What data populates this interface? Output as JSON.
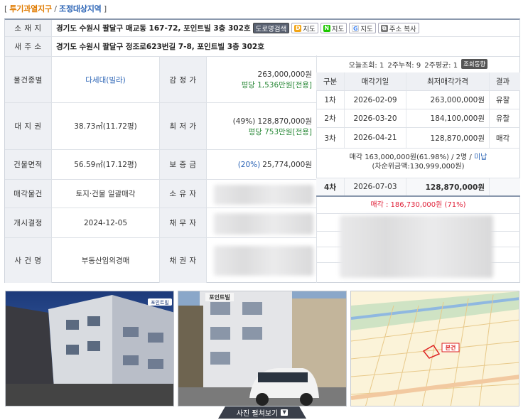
{
  "tags": {
    "open": "[",
    "tag1": "투기과열지구",
    "sep": "/",
    "tag2": "조정대상지역",
    "close": "]"
  },
  "location": {
    "label": "소 재 지",
    "value": "경기도 수원시 팔달구 매교동 167-72, 포인트빌 3층 302호",
    "btn_road": "도로명검색",
    "btn_map_d": "지도",
    "btn_map_n": "지도",
    "btn_map_g": "지도",
    "btn_copy": "주소 복사"
  },
  "new_address": {
    "label": "새 주 소",
    "value": "경기도 수원시 팔달구 정조로623번길 7-8, 포인트빌 3층 302호"
  },
  "fields": {
    "type_label": "물건종별",
    "type_value": "다세대(빌라)",
    "appraisal_label": "감 정 가",
    "appraisal_value": "263,000,000원",
    "appraisal_unit": "평당 1,536만원[전용]",
    "land_label": "대 지 권",
    "land_value": "38.73㎡(11.72평)",
    "min_label": "최 저 가",
    "min_value": "(49%) 128,870,000원",
    "min_unit": "평당 753만원[전용]",
    "building_label": "건물면적",
    "building_value": "56.59㎡(17.12평)",
    "deposit_label": "보 증 금",
    "deposit_pct": "(20%)",
    "deposit_value": "25,774,000원",
    "sale_label": "매각물건",
    "sale_value": "토지·건물 일괄매각",
    "owner_label": "소 유 자",
    "start_label": "개시결정",
    "start_value": "2024-12-05",
    "debtor_label": "채 무 자",
    "case_label": "사 건 명",
    "case_value": "부동산임의경매",
    "creditor_label": "채 권 자"
  },
  "history": {
    "today": "오늘조회: 1",
    "twoweek": "2주누적: 9",
    "avg": "2주평균: 1",
    "trend_btn": "조회동향",
    "headers": [
      "구분",
      "매각기일",
      "최저매각가격",
      "결과"
    ],
    "rows": [
      {
        "round": "1차",
        "date": "2026-02-09",
        "price": "263,000,000원",
        "result": "유찰"
      },
      {
        "round": "2차",
        "date": "2026-03-20",
        "price": "184,100,000원",
        "result": "유찰"
      },
      {
        "round": "3차",
        "date": "2026-04-21",
        "price": "128,870,000원",
        "result": "매각"
      }
    ],
    "sold_line1_a": "매각 163,000,000원(61.98%) / 2명 / ",
    "sold_line1_b": "미납",
    "sold_line2": "(차순위금액:130,999,000원)",
    "next": {
      "round": "4차",
      "date": "2026-07-03",
      "price": "128,870,000원"
    },
    "final_a": "매각 : 186,730,000원",
    "final_b": "(71%)"
  },
  "photos": {
    "p1_badge": "포인트빌",
    "p2_sign": "포인트빌",
    "map_label": "본건"
  },
  "more_photos": "사진 펼쳐보기"
}
